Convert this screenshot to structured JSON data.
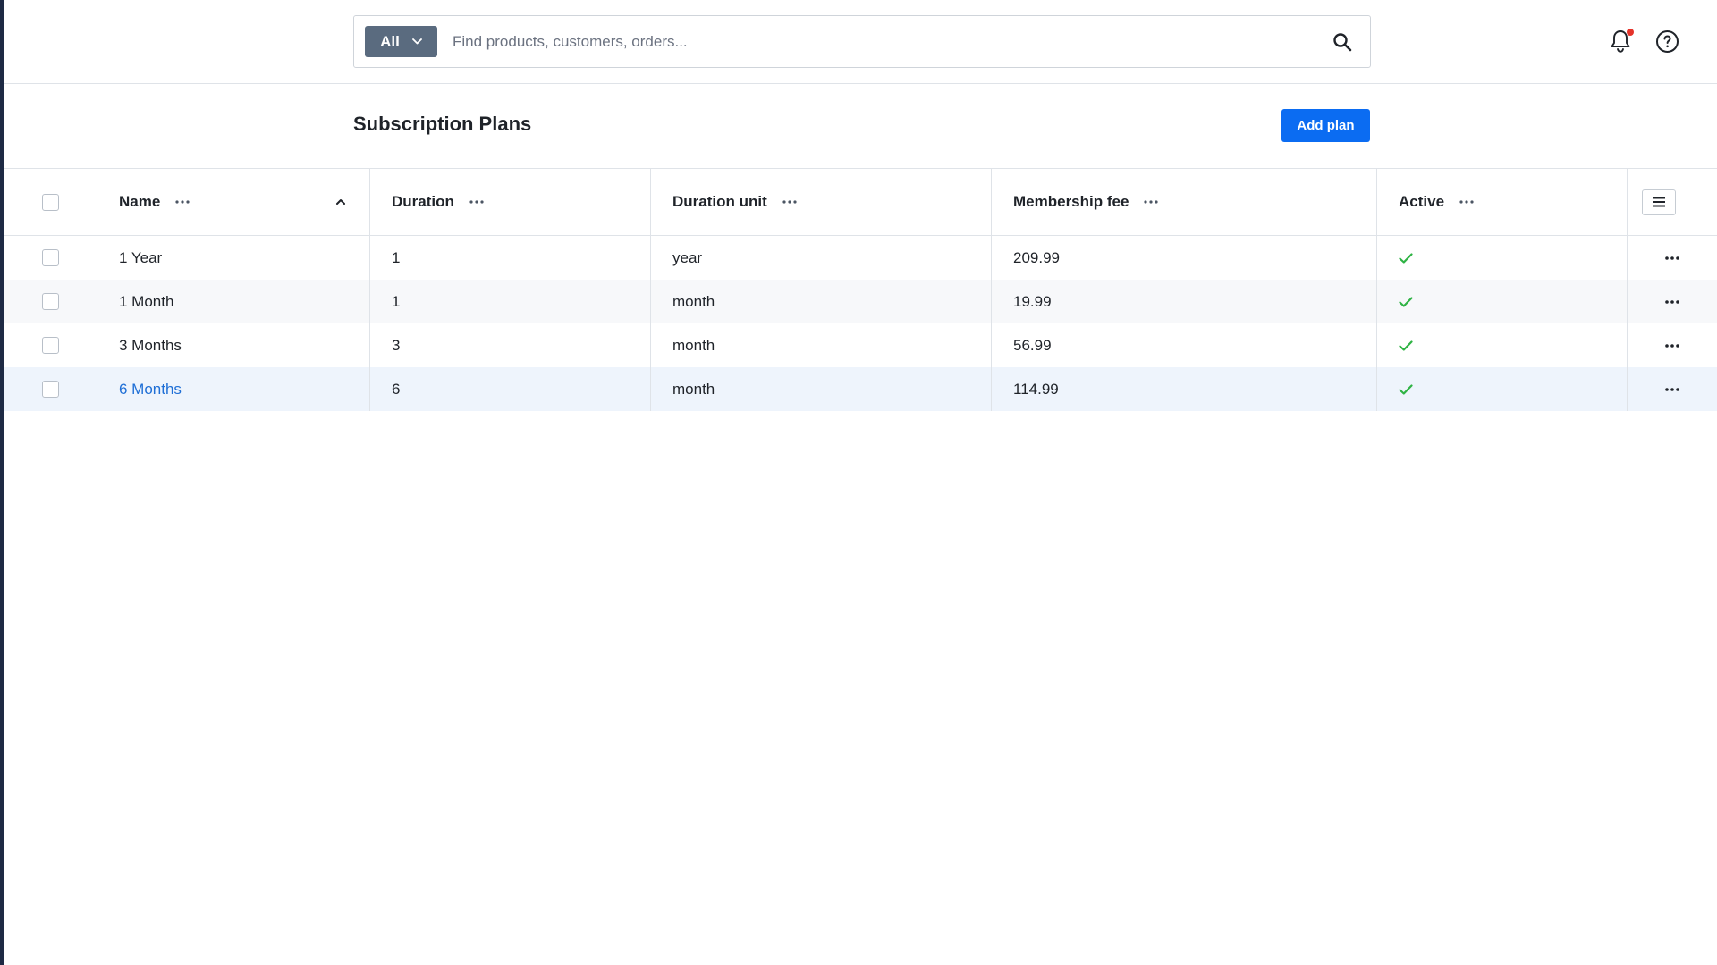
{
  "search": {
    "scope_label": "All",
    "placeholder": "Find products, customers, orders..."
  },
  "header": {
    "title": "Subscription Plans",
    "add_button_label": "Add plan"
  },
  "table": {
    "columns": [
      {
        "label": "Name",
        "sorted": "ascending"
      },
      {
        "label": "Duration"
      },
      {
        "label": "Duration unit"
      },
      {
        "label": "Membership fee"
      },
      {
        "label": "Active"
      }
    ],
    "rows": [
      {
        "name": "1 Year",
        "duration": "1",
        "unit": "year",
        "fee": "209.99",
        "active": true
      },
      {
        "name": "1 Month",
        "duration": "1",
        "unit": "month",
        "fee": "19.99",
        "active": true
      },
      {
        "name": "3 Months",
        "duration": "3",
        "unit": "month",
        "fee": "56.99",
        "active": true
      },
      {
        "name": "6 Months",
        "duration": "6",
        "unit": "month",
        "fee": "114.99",
        "active": true,
        "hovered": true
      }
    ]
  },
  "colors": {
    "accent": "#0b6cf2",
    "link": "#1f6fd6",
    "active_check": "#2fb344",
    "notification_dot": "#e5332a",
    "scope_button": "#5a6b7f"
  },
  "icons": [
    "chevron-down-icon",
    "search-icon",
    "bell-icon",
    "help-icon",
    "more-horizontal-icon",
    "sort-ascending-icon",
    "column-menu-icon",
    "check-icon"
  ]
}
